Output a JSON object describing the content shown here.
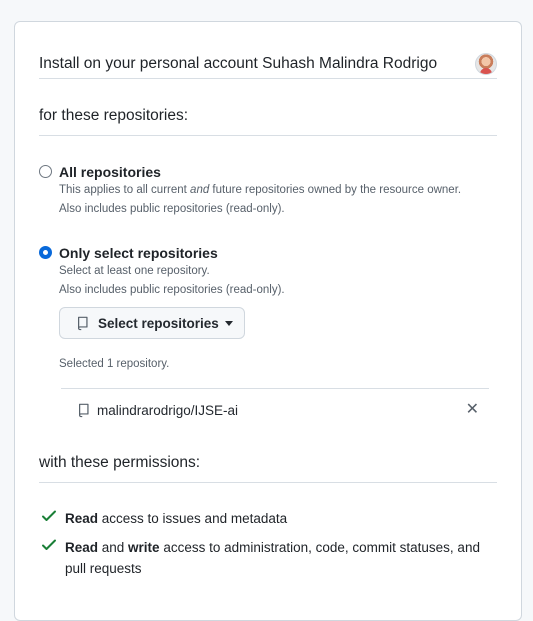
{
  "header": {
    "install_text": "Install on your personal account Suhash Malindra Rodrigo"
  },
  "repositories": {
    "title": "for these repositories:",
    "all": {
      "label": "All repositories",
      "note_line1_pre": "This applies to all current ",
      "note_line1_em": "and",
      "note_line1_post": " future repositories owned by the resource owner.",
      "note_line2": "Also includes public repositories (read-only)."
    },
    "select": {
      "label": "Only select repositories",
      "note_line1": "Select at least one repository.",
      "note_line2": "Also includes public repositories (read-only).",
      "button_label": "Select repositories",
      "selected_count_text": "Selected 1 repository."
    },
    "selected": [
      {
        "full_name": "malindrarodrigo/IJSE-ai"
      }
    ]
  },
  "permissions": {
    "title": "with these permissions:",
    "items": [
      {
        "verb": "Read",
        "rest": " access to issues and metadata"
      },
      {
        "verb": "Read",
        "mid": " and ",
        "verb2": "write",
        "rest": " access to administration, code, commit statuses, and",
        "rest2": "pull requests"
      }
    ]
  },
  "colors": {
    "accent": "#0969da",
    "success": "#1a7f37",
    "muted": "#57606a"
  }
}
